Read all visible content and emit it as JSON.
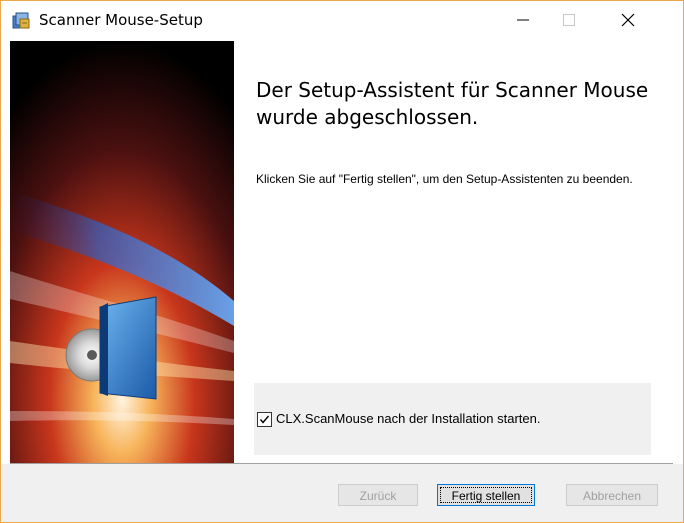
{
  "window": {
    "title": "Scanner Mouse-Setup",
    "controls": {
      "minimize": "—",
      "maximize": "☐",
      "close": "✕"
    }
  },
  "main": {
    "heading": "Der Setup-Assistent für Scanner Mouse wurde abgeschlossen.",
    "description": "Klicken Sie auf \"Fertig stellen\", um den Setup-Assistenten zu beenden.",
    "launch_option": {
      "label": "CLX.ScanMouse nach der Installation starten.",
      "checked": true
    }
  },
  "footer": {
    "back_label": "Zurück",
    "finish_label": "Fertig stellen",
    "cancel_label": "Abbrechen"
  },
  "colors": {
    "accent": "#0078d7",
    "window_border": "#e9a94c",
    "disabled_text": "#a0a0a0"
  }
}
